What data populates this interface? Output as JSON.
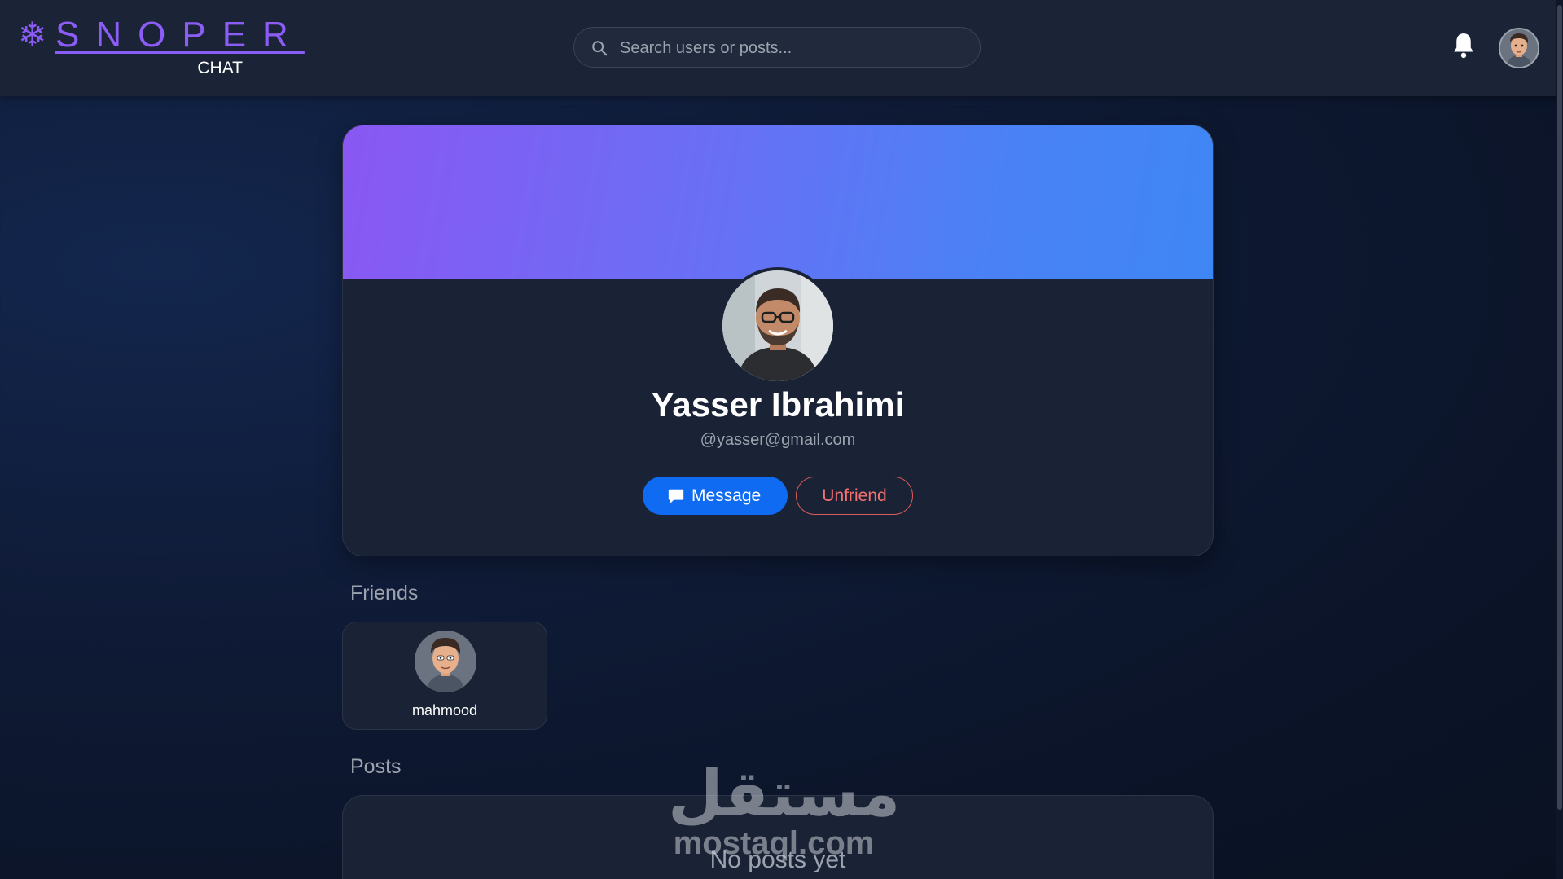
{
  "header": {
    "logo_icon": "snowflake-icon",
    "logo_word": "SNOPER",
    "logo_sub": "CHAT",
    "search_placeholder": "Search users or posts...",
    "notification_icon": "bell-icon"
  },
  "profile": {
    "name": "Yasser Ibrahimi",
    "email": "@yasser@gmail.com",
    "message_label": "Message",
    "unfriend_label": "Unfriend",
    "cover_colors": [
      "#8a57f3",
      "#3f86f5"
    ]
  },
  "friends": {
    "title": "Friends",
    "items": [
      {
        "name": "mahmood"
      }
    ]
  },
  "posts": {
    "title": "Posts",
    "empty_text": "No posts yet"
  },
  "watermark": {
    "arabic": "مستقل",
    "latin": "mostaql.com"
  },
  "colors": {
    "accent": "#8b5cf6",
    "primary_button": "#0f6cf2",
    "danger": "#f87171",
    "surface": "#1a2335",
    "topbar": "#1b2436"
  }
}
